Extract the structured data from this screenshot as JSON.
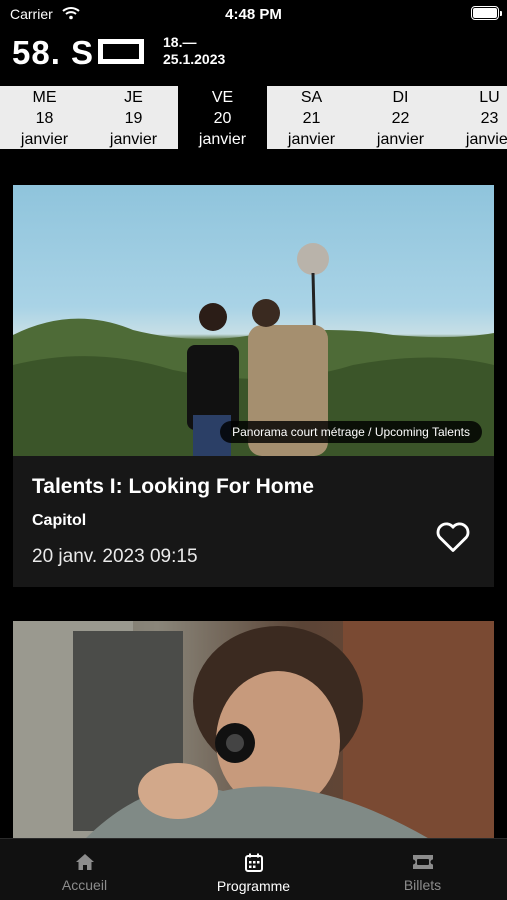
{
  "status_bar": {
    "carrier": "Carrier",
    "time": "4:48 PM"
  },
  "header": {
    "logo_text": "58. S",
    "date_range_line1": "18.—",
    "date_range_line2": "25.1.2023"
  },
  "days": [
    {
      "abbr": "ME",
      "num": "18",
      "month": "janvier",
      "active": false
    },
    {
      "abbr": "JE",
      "num": "19",
      "month": "janvier",
      "active": false
    },
    {
      "abbr": "VE",
      "num": "20",
      "month": "janvier",
      "active": true
    },
    {
      "abbr": "SA",
      "num": "21",
      "month": "janvier",
      "active": false
    },
    {
      "abbr": "DI",
      "num": "22",
      "month": "janvier",
      "active": false
    },
    {
      "abbr": "LU",
      "num": "23",
      "month": "janvier",
      "active": false
    }
  ],
  "events": [
    {
      "tag": "Panorama court métrage / Upcoming Talents",
      "title": "Talents I: Looking For Home",
      "venue": "Capitol",
      "datetime": "20 janv. 2023 09:15",
      "favorite_icon": "heart-outline-icon"
    }
  ],
  "tabs": [
    {
      "label": "Accueil",
      "icon": "home-icon",
      "active": false
    },
    {
      "label": "Programme",
      "icon": "calendar-icon",
      "active": true
    },
    {
      "label": "Billets",
      "icon": "ticket-icon",
      "active": false
    }
  ]
}
